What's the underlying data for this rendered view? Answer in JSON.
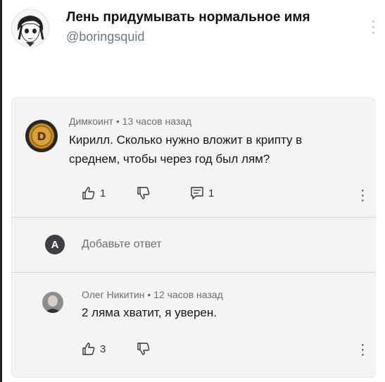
{
  "tweet": {
    "display_name": "Лень придумывать нормальное имя",
    "handle": "@boringsquid"
  },
  "comments": [
    {
      "author": "Димкоинт",
      "time": "13 часов назад",
      "text_line1": "Кирилл. Сколько нужно вложит в крипту в",
      "text_line2": "среднем, чтобы через год был лям?",
      "likes": "1",
      "replies": "1",
      "avatar_letter": "D"
    },
    {
      "author": "Олег Никитин",
      "time": "12 часов назад",
      "text_line1": "2 ляма хватит, я уверен.",
      "likes": "3"
    }
  ],
  "reply_box": {
    "avatar_letter": "A",
    "placeholder": "Добавьте ответ"
  },
  "separator": "•",
  "colors": {
    "coin_gold": "#c28a1e",
    "card_bg": "#f4f4f5",
    "meta_gray": "#6d6d73"
  }
}
